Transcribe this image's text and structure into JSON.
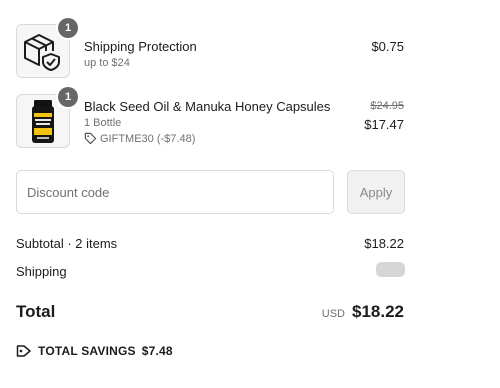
{
  "line_items": [
    {
      "name": "Shipping Protection",
      "detail": "up to $24",
      "quantity": "1",
      "price": "$0.75",
      "image_icon": "box-shield-icon"
    },
    {
      "name": "Black Seed Oil & Manuka Honey Capsules",
      "detail": "1 Bottle",
      "discount": "GIFTME30 (-$7.48)",
      "quantity": "1",
      "original_price": "$24.95",
      "price": "$17.47",
      "image_icon": "supplement-bottle-icon"
    }
  ],
  "discount": {
    "placeholder": "Discount code",
    "apply_label": "Apply"
  },
  "summary": {
    "subtotal_label": "Subtotal · 2 items",
    "subtotal_value": "$18.22",
    "shipping_label": "Shipping",
    "total_label": "Total",
    "currency": "USD",
    "total_value": "$18.22",
    "savings_label": "TOTAL SAVINGS",
    "savings_value": "$7.48"
  }
}
